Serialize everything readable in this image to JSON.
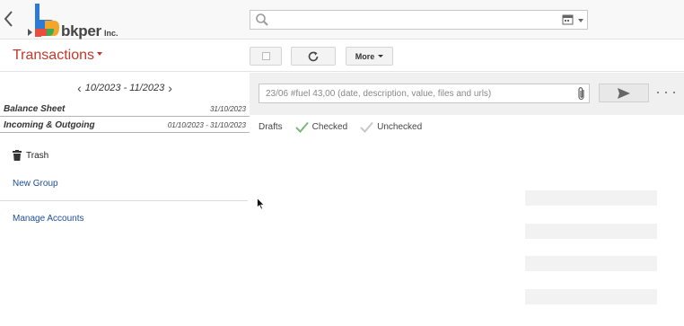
{
  "header": {
    "brand": {
      "word": "bkper",
      "suffix": "Inc."
    },
    "search": {
      "placeholder": "",
      "value": ""
    },
    "icons": [
      "back-arrow-icon",
      "search-icon",
      "calendar-icon",
      "chevron-down-icon"
    ]
  },
  "toolbar": {
    "title": "Transactions",
    "more_label": "More"
  },
  "sidebar": {
    "period": "10/2023 - 11/2023",
    "reports": [
      {
        "name": "Balance Sheet",
        "date": "31/10/2023"
      },
      {
        "name": "Incoming & Outgoing",
        "date": "01/10/2023 - 31/10/2023"
      }
    ],
    "trash_label": "Trash",
    "new_group_label": "New Group",
    "manage_accounts_label": "Manage Accounts"
  },
  "main": {
    "quick_input_placeholder": "23/06 #fuel 43,00 (date, description, value, files and urls)",
    "filters": {
      "drafts": "Drafts",
      "checked": "Checked",
      "unchecked": "Unchecked"
    }
  },
  "colors": {
    "accent": "#c0392b",
    "link": "#1e4c97",
    "logo_blue": "#2d7bd4",
    "logo_red": "#e74c3c",
    "logo_green": "#3aaa55",
    "logo_orange": "#f4a52b",
    "check_green": "#7cb87c",
    "check_grey": "#c8c8c8"
  }
}
